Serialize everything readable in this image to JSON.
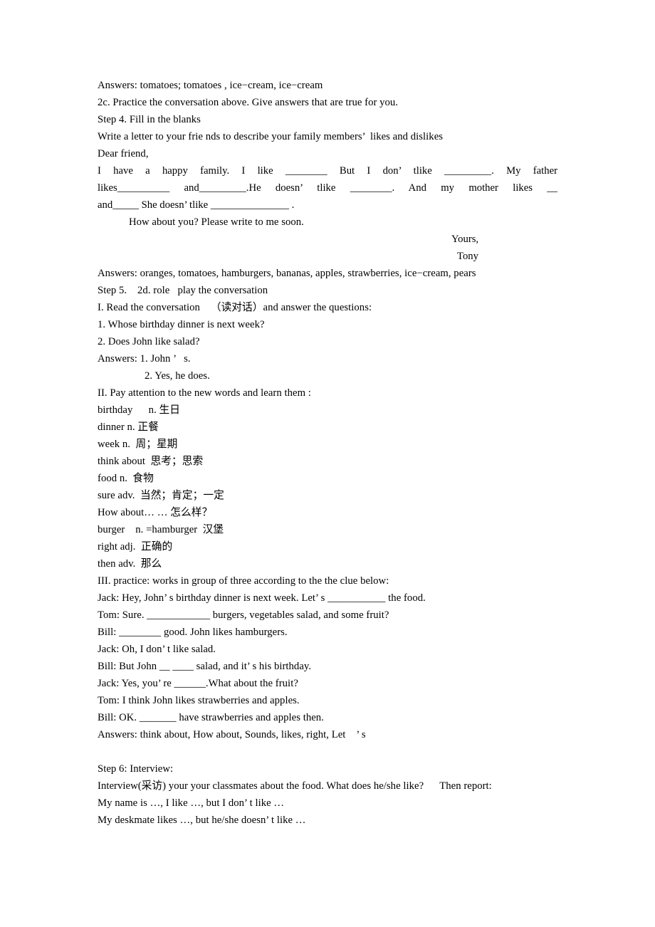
{
  "document": {
    "type": "worksheet",
    "subject": "English lesson plan - food likes and dislikes",
    "page_background": "#ffffff",
    "text_color": "#000000"
  },
  "lines": {
    "answers_2b": "Answers: tomatoes; tomatoes , ice−cream, ice−cream",
    "task_2c": "2c. Practice the conversation above. Give answers that are true for you.",
    "step4_title": "Step 4. Fill in the blanks",
    "step4_instruction": "Write a letter to your frie nds to describe your family members’  likes and dislikes",
    "letter_salutation": "Dear friend,",
    "letter_body_l1": "I   have  a  happy  family.  I  like  ________   But  I  don’ tlike  _________.   My  father",
    "letter_body_l2": "likes__________     and_________.He  doesn’ tlike  ________.    And  my  mother  likes  __",
    "letter_body_l3": "and_____ She doesn’ tlike _______________       .",
    "letter_closing_question": "How about you? Please write to me soon.",
    "letter_yours": "Yours,",
    "letter_signature": "Tony",
    "answers_letter": "Answers: oranges, tomatoes, hamburgers, bananas, apples, strawberries, ice−cream, pears",
    "step5_title": "Step 5.    2d. role   play the conversation",
    "section_I": "I. Read the conversation    （读对话）and answer the questions:",
    "q1": "1. Whose birthday dinner is next week?",
    "q2": "2. Does John like salad?",
    "answers_q_line1": "Answers: 1. John ’   s.",
    "answers_q_line2": "2. Yes, he does.",
    "section_II": "II. Pay attention to the new words and learn them :",
    "section_III": "III. practice: works in group of three according to the the clue below:",
    "dialogue_jack_1": "Jack: Hey, John’ s birthday dinner is next week. Let’ s ___________ the food.",
    "dialogue_tom_1": "Tom: Sure. ____________ burgers, vegetables salad, and some fruit?",
    "dialogue_bill_1": "Bill: ________ good. John likes hamburgers.",
    "dialogue_jack_2": "Jack: Oh, I don’ t like salad.",
    "dialogue_bill_2": "Bill: But John __ ____ salad, and it’ s his birthday.",
    "dialogue_jack_3": "Jack: Yes, you’ re ______.What about the fruit?",
    "dialogue_tom_2": "Tom: I think John likes strawberries and apples.",
    "dialogue_bill_3": "Bill: OK. _______ have strawberries and apples then.",
    "answers_dialogue": "Answers: think about, How about, Sounds, likes, right, Let    ’ s",
    "step6_title": "Step 6: Interview:",
    "step6_instruction": "Interview(采访) your your classmates about the food. What does he/she like?      Then report:",
    "step6_model_1": "My name is …, I like …, but I don’ t like …",
    "step6_model_2": "My deskmate likes …, but he/she doesn’ t like …"
  },
  "vocabulary": [
    {
      "word": "birthday",
      "pos": "n.",
      "meaning": "生日",
      "raw": "birthday      n. 生日"
    },
    {
      "word": "dinner",
      "pos": "n.",
      "meaning": "正餐",
      "raw": "dinner n. 正餐"
    },
    {
      "word": "week",
      "pos": "n.",
      "meaning": "周；星期",
      "raw": "week n.  周；星期"
    },
    {
      "word": "think about",
      "pos": "",
      "meaning": "思考；思索",
      "raw": "think about  思考；思索"
    },
    {
      "word": "food",
      "pos": "n.",
      "meaning": "食物",
      "raw": "food n.  食物"
    },
    {
      "word": "sure",
      "pos": "adv.",
      "meaning": "当然；肯定；一定",
      "raw": "sure adv.  当然；肯定；一定"
    },
    {
      "word": "How about",
      "pos": "",
      "meaning": "… … 怎么样？",
      "raw": "How about… … 怎么样？"
    },
    {
      "word": "burger",
      "pos": "n.",
      "meaning": "=hamburger  汉堡",
      "raw": "burger    n. =hamburger  汉堡"
    },
    {
      "word": "right",
      "pos": "adj.",
      "meaning": "正确的",
      "raw": "right adj.  正确的"
    },
    {
      "word": "then",
      "pos": "adv.",
      "meaning": "那么",
      "raw": "then adv.  那么"
    }
  ]
}
